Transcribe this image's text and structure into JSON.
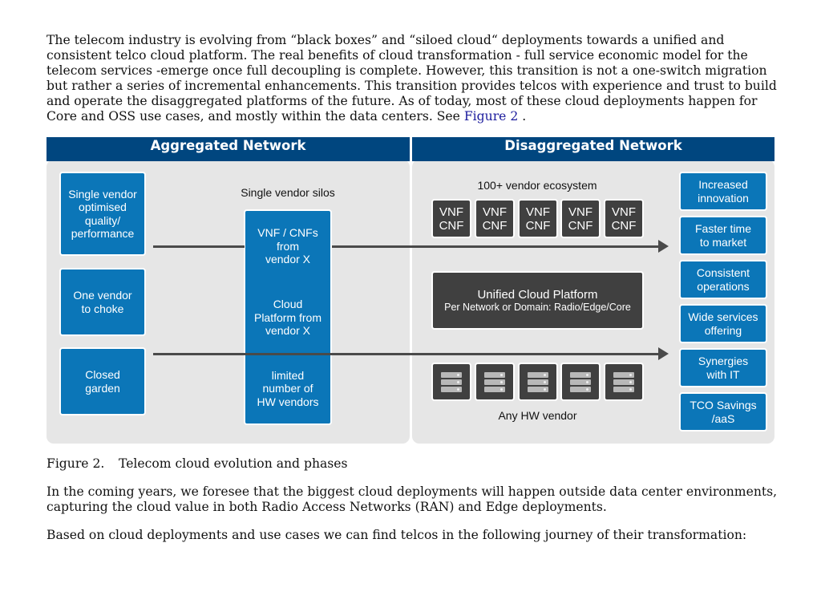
{
  "intro_paragraph": {
    "text": "The telecom industry is evolving from “black boxes” and “siloed cloud“ deployments towards a unified and consistent telco cloud platform. The real benefits of cloud transformation - full service economic model for the telecom services -emerge once full decoupling is complete. However, this transition is not a one-switch migration but rather a series of incremental enhancements. This transition provides telcos with experience and trust to build and operate the disaggregated platforms of the future. As of today, most of these cloud deployments happen for Core and OSS use cases, and mostly within the data centers. See ",
    "link_text": "Figure 2",
    "trailing": " ."
  },
  "figure": {
    "colors": {
      "header": "#00467f",
      "blue_box": "#0b76b8",
      "dark_box": "#404040",
      "panel": "#e6e6e6",
      "arrow": "#4a4a4a"
    },
    "aggregated": {
      "title": "Aggregated Network",
      "left_boxes": [
        "Single vendor\noptimised\nquality/\nperformance",
        "One vendor\nto choke",
        "Closed\ngarden"
      ],
      "silos_label": "Single vendor silos",
      "silo_stack": [
        "VNF / CNFs\nfrom\nvendor X",
        "Cloud\nPlatform from\nvendor X",
        "limited\nnumber of\nHW vendors"
      ]
    },
    "disaggregated": {
      "title": "Disaggregated Network",
      "ecosystem_label": "100+ vendor ecosystem",
      "vnf_tiles": [
        "VNF\nCNF",
        "VNF\nCNF",
        "VNF\nCNF",
        "VNF\nCNF",
        "VNF\nCNF"
      ],
      "platform_title": "Unified Cloud Platform",
      "platform_subtitle": "Per Network or Domain: Radio/Edge/Core",
      "hw_icon": "server-rack-icon",
      "hw_label": "Any HW vendor",
      "benefits": [
        "Increased\ninnovation",
        "Faster time\nto market",
        "Consistent\noperations",
        "Wide services\noffering",
        "Synergies\nwith IT",
        "TCO Savings\n/aaS"
      ]
    }
  },
  "caption": {
    "number": "Figure 2.",
    "text": "Telecom cloud evolution and phases"
  },
  "paragraph_2": "In the coming years, we foresee that the biggest cloud deployments will happen outside data center environments, capturing the cloud value in both Radio Access Networks (RAN) and Edge deployments.",
  "paragraph_3": "Based on cloud deployments and use cases we can find telcos in the following journey of their transformation:"
}
